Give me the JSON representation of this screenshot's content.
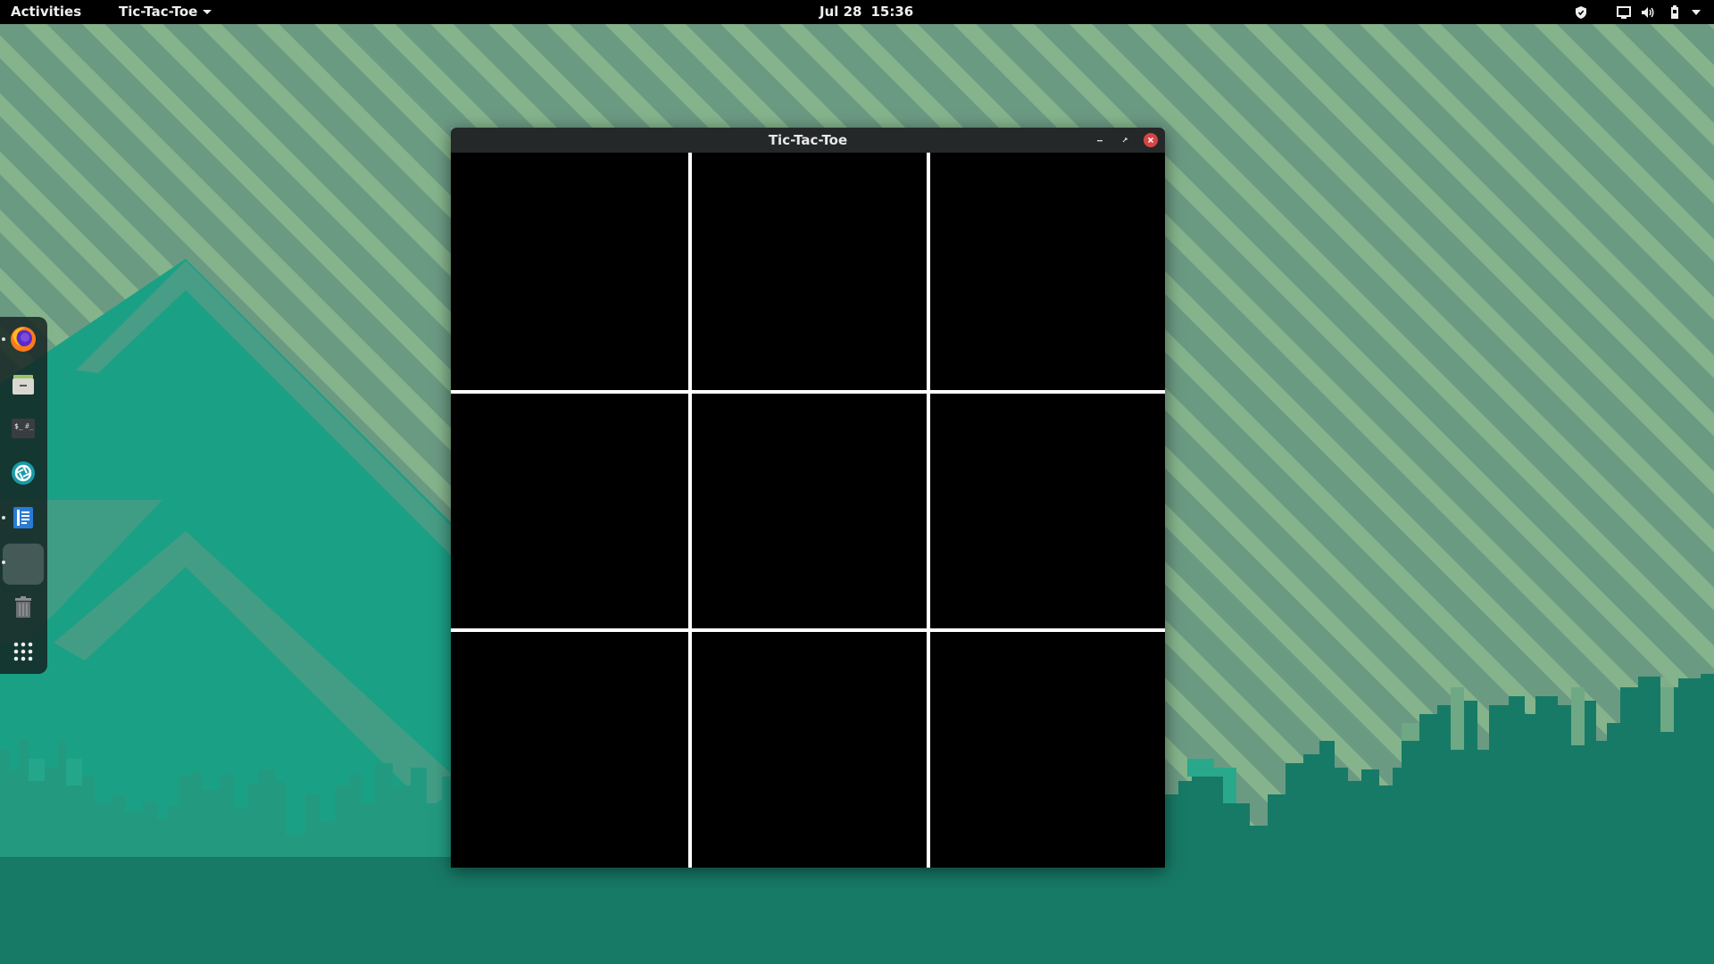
{
  "topbar": {
    "activities_label": "Activities",
    "app_menu_label": "Tic-Tac-Toe",
    "clock_date": "Jul 28",
    "clock_time": "15:36"
  },
  "tray_icons": [
    "shield-icon",
    "screen-icon",
    "volume-icon",
    "battery-icon",
    "system-menu-arrow-icon"
  ],
  "dock": {
    "items": [
      {
        "name": "firefox",
        "icon": "firefox-icon",
        "running": true
      },
      {
        "name": "files",
        "icon": "file-cabinet-icon",
        "running": false
      },
      {
        "name": "terminal",
        "icon": "terminal-icon",
        "running": false
      },
      {
        "name": "software",
        "icon": "aperture-icon",
        "running": false
      },
      {
        "name": "text-editor",
        "icon": "notes-icon",
        "running": true
      },
      {
        "name": "tic-tac-toe",
        "icon": "blank-app-icon",
        "running": true
      },
      {
        "name": "trash",
        "icon": "trash-icon",
        "running": false
      },
      {
        "name": "show-applications",
        "icon": "app-grid-icon",
        "running": false
      }
    ]
  },
  "window": {
    "title": "Tic-Tac-Toe",
    "buttons": [
      "minimize",
      "maximize",
      "close"
    ]
  },
  "board": {
    "rows": 3,
    "cols": 3,
    "cells": [
      "",
      "",
      "",
      "",
      "",
      "",
      "",
      "",
      ""
    ]
  },
  "colors": {
    "topbar": "#000000",
    "board_background": "#000000",
    "grid_lines": "#ffffff",
    "close_button": "#d64545",
    "wallpaper_teal": "#1aa085",
    "wallpaper_dark_teal": "#177a66",
    "wallpaper_sage": "#6a9a82"
  }
}
